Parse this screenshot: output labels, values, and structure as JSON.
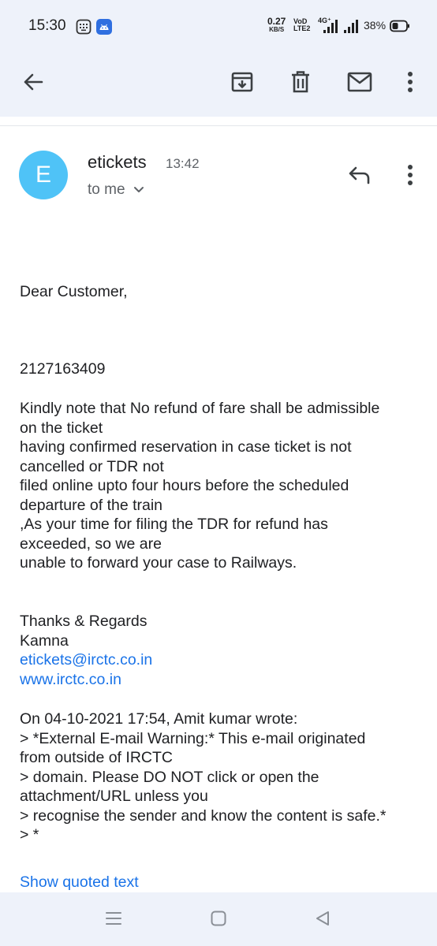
{
  "status_bar": {
    "time": "15:30",
    "net_speed": "0.27",
    "net_unit": "KB/S",
    "volte_top": "VoD",
    "volte_bottom": "LTE2",
    "signal_label": "4G⁺",
    "battery": "38%",
    "icons": [
      "screenshot-icon",
      "android-icon",
      "signal-icon",
      "battery-icon"
    ]
  },
  "toolbar": {
    "back_icon": "arrow-left-icon",
    "archive_icon": "archive-icon",
    "delete_icon": "trash-icon",
    "mark_unread_icon": "mail-icon",
    "more_icon": "more-vertical-icon"
  },
  "message": {
    "avatar_letter": "E",
    "sender": "etickets",
    "time": "13:42",
    "recipient": "to me",
    "reply_icon": "reply-icon",
    "more_icon": "more-vertical-icon",
    "body": {
      "greeting": "Dear Customer,",
      "ticket_number": "2127163409",
      "paragraph": [
        "Kindly note that No refund of fare shall be admissible",
        "on the ticket",
        "having confirmed reservation in case ticket is not",
        "cancelled or TDR not",
        "filed online upto four hours before the scheduled",
        "departure of the train",
        ",As your time for filing the TDR for refund has",
        "exceeded, so we are",
        "unable to forward your case to Railways."
      ],
      "signoff": "Thanks & Regards",
      "signer": "Kamna",
      "email_link": "etickets@irctc.co.in",
      "web_link": "www.irctc.co.in",
      "quote": [
        "On 04-10-2021 17:54, Amit kumar wrote:",
        "> *External E-mail Warning:* This e-mail originated",
        "from outside of IRCTC",
        "> domain. Please DO NOT click or open the",
        "attachment/URL unless you",
        "> recognise the sender and know the content is safe.*",
        "> *"
      ]
    },
    "show_quoted": "Show quoted text"
  },
  "nav_bar": {
    "recents_icon": "recents-icon",
    "home_icon": "home-icon",
    "back_icon": "back-triangle-icon"
  },
  "colors": {
    "header_bg": "#eef2fa",
    "avatar": "#4fc3f7",
    "link": "#1a73e8",
    "text": "#202124",
    "secondary_text": "#5f6368"
  }
}
